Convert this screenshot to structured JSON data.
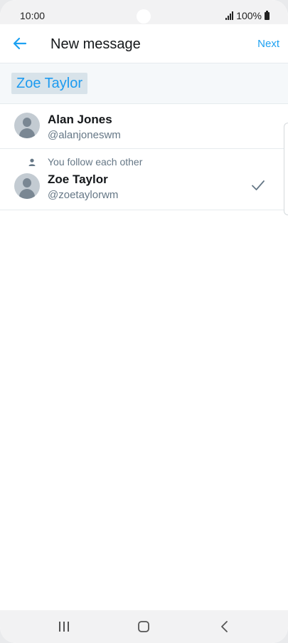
{
  "status_bar": {
    "time": "10:00",
    "battery": "100%"
  },
  "header": {
    "title": "New message",
    "next_label": "Next"
  },
  "to_field": {
    "recipient": "Zoe Taylor"
  },
  "contacts": [
    {
      "name": "Alan Jones",
      "handle": "@alanjoneswm",
      "note": "",
      "selected": false
    },
    {
      "name": "Zoe Taylor",
      "handle": "@zoetaylorwm",
      "note": "You follow each other",
      "selected": true
    }
  ],
  "colors": {
    "accent": "#1da1f2",
    "secondary_text": "#657786",
    "primary_text": "#14171a"
  },
  "icons": {
    "back": "arrow-left-icon",
    "follow": "person-icon",
    "selected": "check-icon",
    "nav_recents": "recents-icon",
    "nav_home": "home-icon",
    "nav_back": "back-icon"
  }
}
